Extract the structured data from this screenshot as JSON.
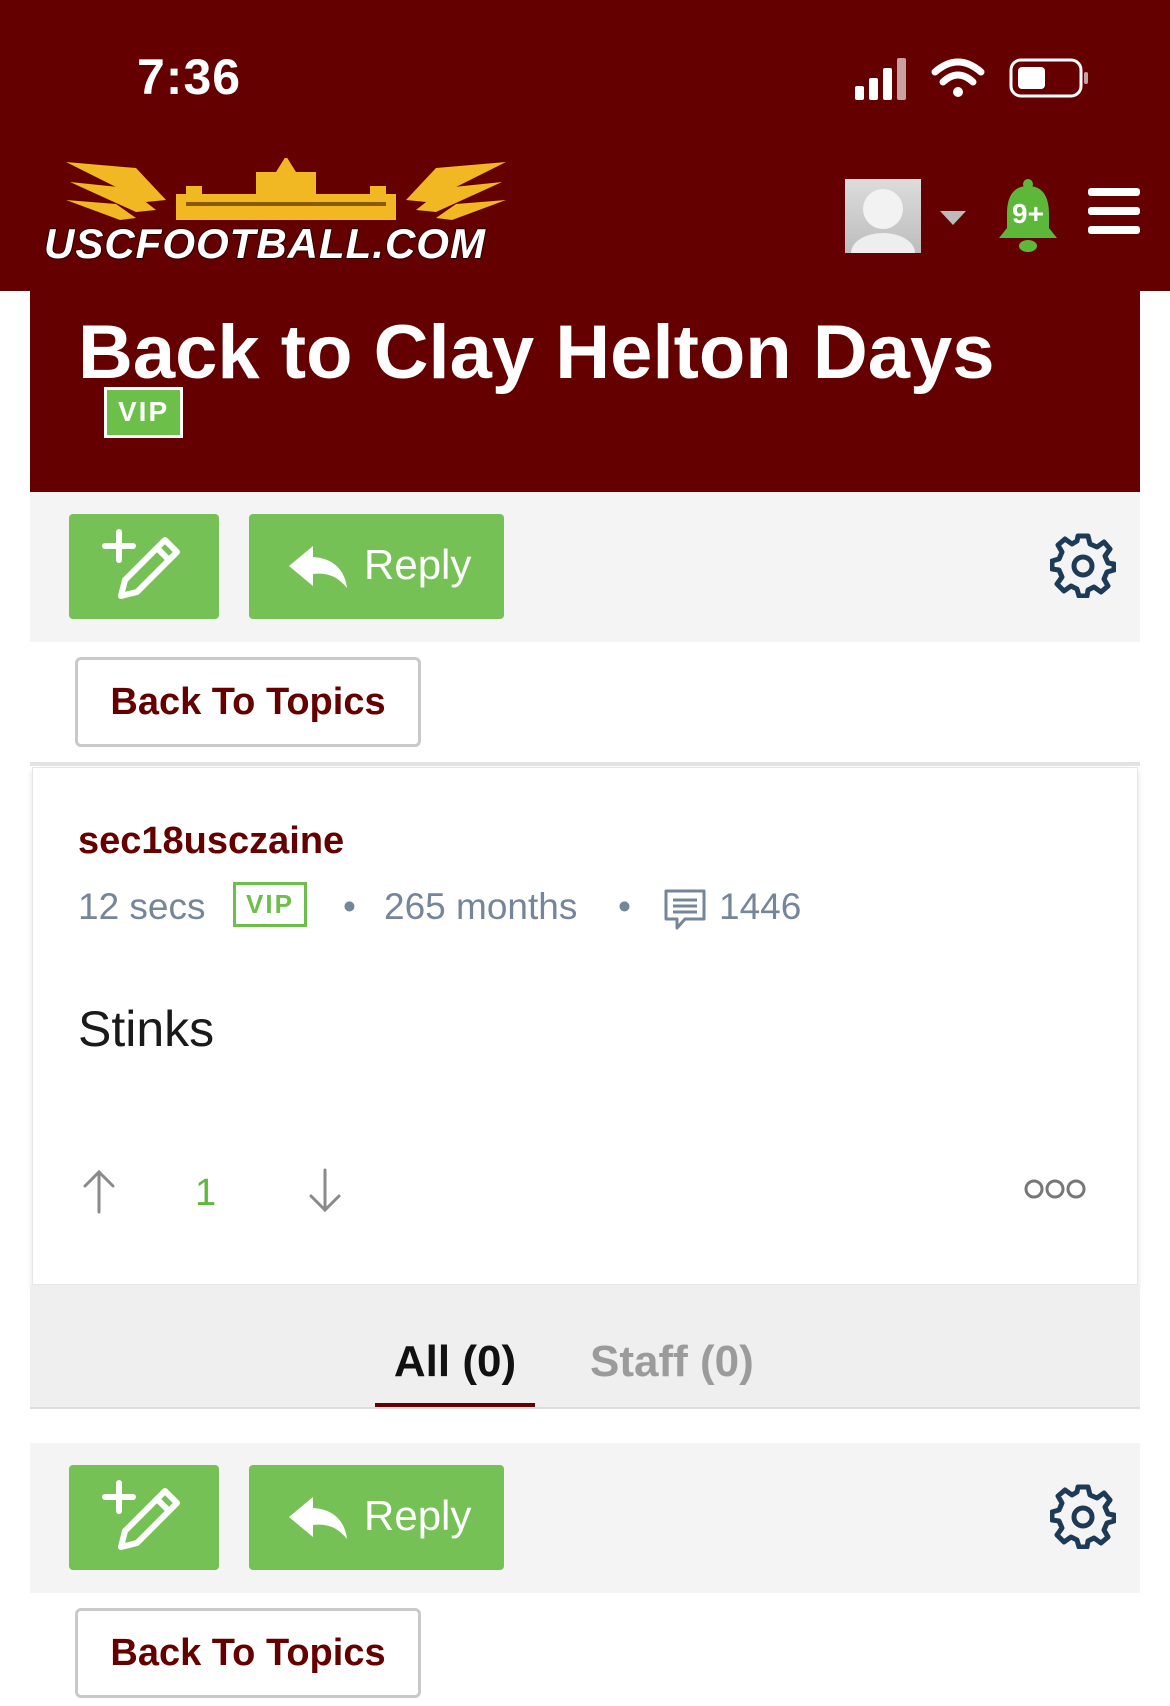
{
  "status_bar": {
    "time": "7:36"
  },
  "site": {
    "logo_text": "USCFOOTBALL.COM",
    "notifications_count": "9+"
  },
  "topic": {
    "title": "Back to Clay Helton Days",
    "badge": "VIP"
  },
  "toolbar": {
    "reply_label": "Reply"
  },
  "navigation": {
    "back_to_topics": "Back To Topics"
  },
  "post": {
    "author": "sec18usczaine",
    "time_ago": "12 secs",
    "badge": "VIP",
    "member_for": "265 months",
    "post_count": "1446",
    "body": "Stinks",
    "votes": "1"
  },
  "tabs": {
    "all": "All (0)",
    "staff": "Staff (0)"
  },
  "colors": {
    "brand": "#650000",
    "accent_green": "#76c155",
    "meta_gray": "#76869a"
  },
  "icons": [
    "signal-icon",
    "wifi-icon",
    "battery-icon",
    "bell-icon",
    "menu-icon",
    "new-topic-icon",
    "reply-arrow-icon",
    "gear-icon",
    "comment-icon",
    "arrow-up-icon",
    "arrow-down-icon",
    "more-icon"
  ]
}
